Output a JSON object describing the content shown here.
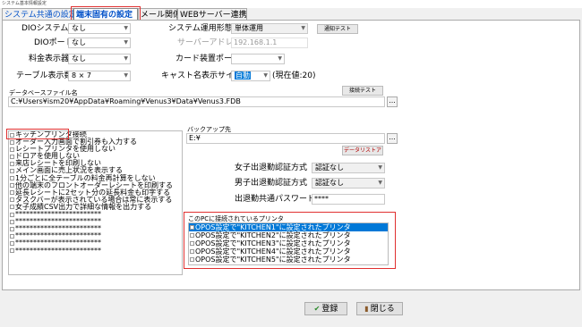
{
  "window": {
    "title": "システム基本情報設定"
  },
  "tabs": [
    {
      "label": "システム共通の設定"
    },
    {
      "label": "端末固有の設定"
    },
    {
      "label": "メール関係"
    },
    {
      "label": "WEBサーバー連携"
    }
  ],
  "fields": {
    "dio_system": {
      "label": "DIOシステム",
      "value": "なし"
    },
    "dio_port": {
      "label": "DIOポート",
      "value": "なし"
    },
    "fee_display": {
      "label": "料金表示器",
      "value": "なし"
    },
    "table_display_count": {
      "label": "テーブル表示数",
      "value": "8 × 7"
    },
    "system_mode": {
      "label": "システム運用形態",
      "value": "単体運用"
    },
    "server_address": {
      "label": "サーバーアドレス",
      "value": "192.168.1.1"
    },
    "card_port": {
      "label": "カード装置ポート",
      "value": ""
    },
    "cast_font_size": {
      "label": "キャスト名表示サイズ",
      "value": "自動",
      "current": "(現在値:20)"
    },
    "db_file": {
      "label": "データベースファイル名",
      "value": "C:¥Users¥ism20¥AppData¥Roaming¥Venus3¥Data¥Venus3.FDB"
    },
    "backup_dest": {
      "label": "バックアップ先",
      "value": "E:¥"
    },
    "female_auth": {
      "label": "女子出退勤認証方式",
      "value": "認証なし"
    },
    "male_auth": {
      "label": "男子出退勤認証方式",
      "value": "認証なし"
    },
    "common_password": {
      "label": "出退勤共通パスワード",
      "value": "****"
    }
  },
  "buttons": {
    "comm_test": "通知テスト",
    "conn_test": "接続テスト",
    "data_restore": "データリストア",
    "ok": "登録",
    "close": "閉じる",
    "browse": "..."
  },
  "options_list": [
    "キッチンプリンタ接続",
    "オーダー入力画面で割引券も入力する",
    "レシートプリンタを使用しない",
    "ドロアを使用しない",
    "来店レシートを印刷しない",
    "メイン画面に売上状況を表示する",
    "1分ごとに全テーブルの料金再計算をしない",
    "他の端末のフロントオーダーレシートを印刷する",
    "延長レシートに2セット分の延長料金も印字する",
    "タスクバーが表示されている場合は常に表示する",
    "女子成績CSV出力で詳細な情報を出力する",
    "************************",
    "************************",
    "************************",
    "************************",
    "************************",
    "************************"
  ],
  "printers": {
    "label": "このPCに接続されているプリンタ",
    "items": [
      "OPOS設定で\"KITCHEN1\"に設定されたプリンタ",
      "OPOS設定で\"KITCHEN2\"に設定されたプリンタ",
      "OPOS設定で\"KITCHEN3\"に設定されたプリンタ",
      "OPOS設定で\"KITCHEN4\"に設定されたプリンタ",
      "OPOS設定で\"KITCHEN5\"に設定されたプリンタ"
    ]
  },
  "colors": {
    "accent": "#0078d7",
    "tab_active": "#0050c8",
    "highlight_box": "#e03030"
  }
}
